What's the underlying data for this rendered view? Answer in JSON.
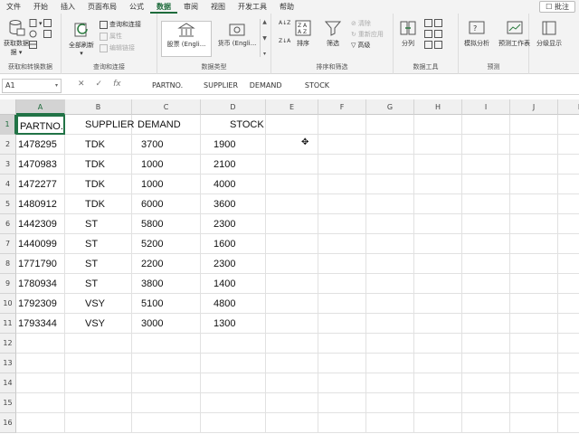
{
  "menu": {
    "tabs": [
      "文件",
      "开始",
      "插入",
      "页面布局",
      "公式",
      "数据",
      "审阅",
      "视图",
      "开发工具",
      "帮助"
    ],
    "active": "数据",
    "comment_label": "批注"
  },
  "ribbon": {
    "get_data": {
      "label": "获取数据",
      "sub": "据 ▾",
      "group": "获取和转换数据"
    },
    "refresh": {
      "label": "全部刷新",
      "group": "查询和连接",
      "items": [
        "查询和连接",
        "属性",
        "编辑链接"
      ]
    },
    "data_types": {
      "group": "数据类型",
      "stocks": "股票 (Engli...",
      "currency": "货币 (Engli..."
    },
    "sort_filter": {
      "group": "排序和筛选",
      "sort": "排序",
      "filter": "筛选",
      "clear": "清除",
      "reapply": "重新应用",
      "advanced": "高级",
      "az": "A↓Z",
      "za": "Z↓A"
    },
    "tools": {
      "group": "数据工具",
      "split": "分列"
    },
    "forecast": {
      "group": "预测",
      "whatif": "模拟分析",
      "sheet": "预测工作表"
    },
    "outline": {
      "label": "分级显示"
    }
  },
  "formula_bar": {
    "name_box": "A1",
    "fx": "fx",
    "content": "PARTNO.         SUPPLIER     DEMAND          STOCK"
  },
  "columns": [
    "A",
    "B",
    "C",
    "D",
    "E",
    "F",
    "G",
    "H",
    "I",
    "J",
    "K"
  ],
  "rows": [
    "1",
    "2",
    "3",
    "4",
    "5",
    "6",
    "7",
    "8",
    "9",
    "10",
    "11",
    "12",
    "13",
    "14",
    "15",
    "16"
  ],
  "sheet": {
    "header": {
      "partno": "PARTNO.",
      "supplier": "SUPPLIER",
      "demand": "DEMAND",
      "stock": "STOCK"
    },
    "records": [
      {
        "partno": "1478295",
        "supplier": "TDK",
        "demand": "3700",
        "stock": "1900"
      },
      {
        "partno": "1470983",
        "supplier": "TDK",
        "demand": "1000",
        "stock": "2100"
      },
      {
        "partno": "1472277",
        "supplier": "TDK",
        "demand": "1000",
        "stock": "4000"
      },
      {
        "partno": "1480912",
        "supplier": "TDK",
        "demand": "6000",
        "stock": "3600"
      },
      {
        "partno": "1442309",
        "supplier": "ST",
        "demand": "5800",
        "stock": "2300"
      },
      {
        "partno": "1440099",
        "supplier": "ST",
        "demand": "5200",
        "stock": "1600"
      },
      {
        "partno": "1771790",
        "supplier": "ST",
        "demand": "2200",
        "stock": "2300"
      },
      {
        "partno": "1780934",
        "supplier": "ST",
        "demand": "3800",
        "stock": "1400"
      },
      {
        "partno": "1792309",
        "supplier": "VSY",
        "demand": "5100",
        "stock": "4800"
      },
      {
        "partno": "1793344",
        "supplier": "VSY",
        "demand": "3000",
        "stock": "1300"
      }
    ]
  },
  "colors": {
    "accent": "#217346",
    "ribbon_bg": "#f3f3f3"
  }
}
